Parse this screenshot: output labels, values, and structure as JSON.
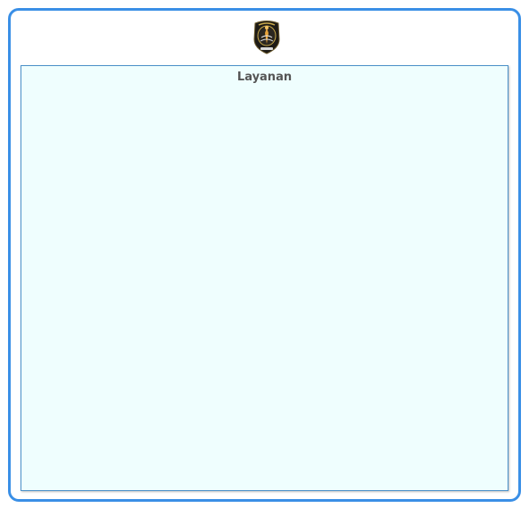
{
  "panel": {
    "title": "Layanan"
  },
  "logo": {
    "icon": "university-emblem-icon"
  },
  "colors": {
    "frame_border": "#3a8fe6",
    "panel_border": "#4a90c9",
    "panel_background": "#effefe",
    "title_text": "#555555"
  }
}
